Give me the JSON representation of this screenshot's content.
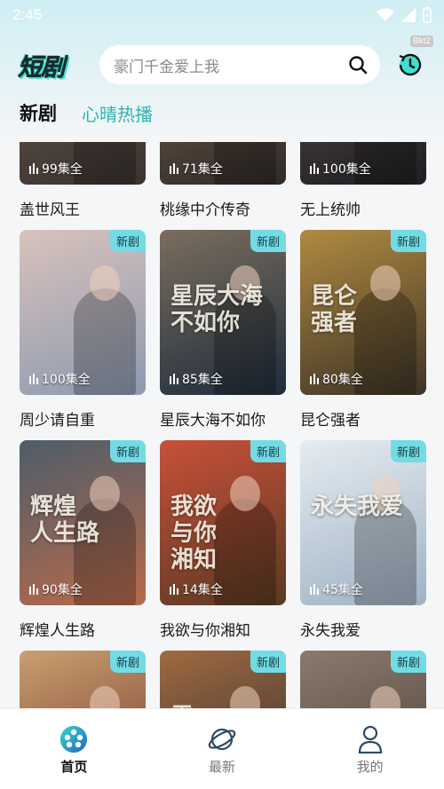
{
  "status_bar": {
    "time": "2:45"
  },
  "header": {
    "logo": "短剧",
    "search_placeholder": "豪门千金爱上我",
    "history_badge": "Bkt2"
  },
  "tabs": [
    {
      "label": "新剧",
      "active": true
    },
    {
      "label": "心晴热播",
      "active": false
    }
  ],
  "badge_text": "新剧",
  "cards": [
    {
      "title": "盖世风王",
      "episodes": "99集全",
      "badge": false,
      "colors": [
        "#3a3330",
        "#6a5a4e"
      ]
    },
    {
      "title": "桃缘中介传奇",
      "episodes": "71集全",
      "badge": false,
      "colors": [
        "#2f2a28",
        "#7b6250"
      ]
    },
    {
      "title": "无上统帅",
      "episodes": "100集全",
      "badge": false,
      "colors": [
        "#1f1e22",
        "#5a5050"
      ]
    },
    {
      "title": "周少请自重",
      "episodes": "100集全",
      "badge": true,
      "colors": [
        "#8d9ab0",
        "#d8c2bc"
      ]
    },
    {
      "title": "星辰大海不如你",
      "episodes": "85集全",
      "badge": true,
      "colors": [
        "#1f2d3c",
        "#7a6d5e"
      ]
    },
    {
      "title": "昆仑强者",
      "episodes": "80集全",
      "badge": true,
      "colors": [
        "#3e3428",
        "#b08a40"
      ]
    },
    {
      "title": "辉煌人生路",
      "episodes": "90集全",
      "badge": true,
      "colors": [
        "#b96a4a",
        "#4e5d6a"
      ]
    },
    {
      "title": "我欲与你湘知",
      "episodes": "14集全",
      "badge": true,
      "colors": [
        "#5a3a22",
        "#c8503a"
      ]
    },
    {
      "title": "永失我爱",
      "episodes": "45集全",
      "badge": true,
      "colors": [
        "#9fb2c4",
        "#e5ecf1"
      ]
    },
    {
      "title": "",
      "episodes": "",
      "badge": true,
      "colors": [
        "#6e2f28",
        "#c9a070"
      ]
    },
    {
      "title": "",
      "episodes": "",
      "badge": true,
      "colors": [
        "#2a2a30",
        "#a06a40"
      ]
    },
    {
      "title": "",
      "episodes": "",
      "badge": true,
      "colors": [
        "#4a3c34",
        "#8a7a6e"
      ]
    }
  ],
  "poster_art": [
    "",
    "",
    "",
    "",
    "星辰大海\n不如你",
    "昆仑\n强者",
    "辉煌\n人生路",
    "我欲\n与你\n湘知",
    "永失我爱",
    "",
    "霜",
    ""
  ],
  "bottom_nav": [
    {
      "label": "首页",
      "icon": "film-reel-icon",
      "active": true
    },
    {
      "label": "最新",
      "icon": "planet-icon",
      "active": false
    },
    {
      "label": "我的",
      "icon": "user-icon",
      "active": false
    }
  ]
}
